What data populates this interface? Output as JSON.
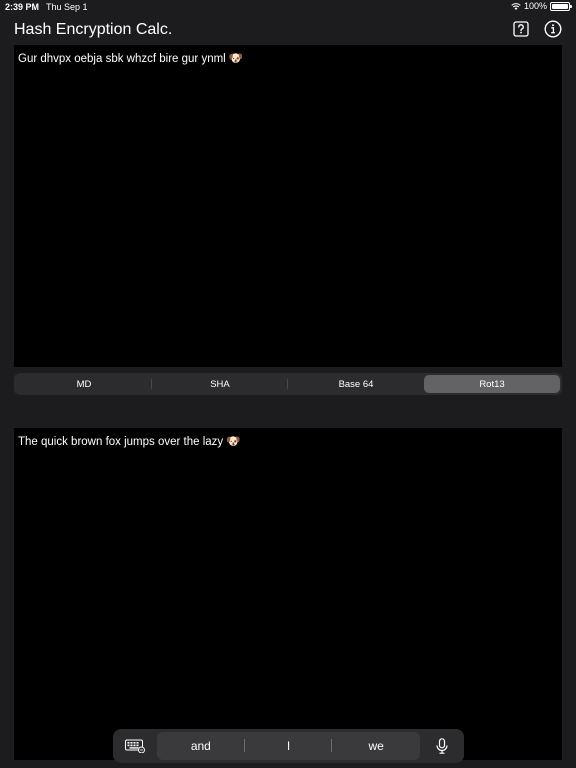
{
  "status_bar": {
    "time": "2:39 PM",
    "date": "Thu Sep 1",
    "battery": "100%",
    "battery_level": 1.0
  },
  "nav": {
    "title": "Hash Encryption Calc.",
    "icons": [
      "help-square-icon",
      "info-circle-icon"
    ]
  },
  "input_panel": {
    "text": "Gur dhvpx oebja sbk whzcf bire gur ynml 🐶"
  },
  "segments": {
    "items": [
      {
        "label": "MD",
        "selected": false
      },
      {
        "label": "SHA",
        "selected": false
      },
      {
        "label": "Base 64",
        "selected": false
      },
      {
        "label": "Rot13",
        "selected": true
      }
    ]
  },
  "output_panel": {
    "text": "The quick brown fox jumps over the lazy 🐶"
  },
  "keyboard_bar": {
    "left_icon": "keyboard-icon",
    "right_icon": "microphone-icon",
    "suggestions": [
      "and",
      "I",
      "we"
    ]
  },
  "colors": {
    "background": "#1c1c1e",
    "panel": "#000000",
    "segment_bg": "#2c2c2e",
    "segment_selected": "#636366"
  }
}
